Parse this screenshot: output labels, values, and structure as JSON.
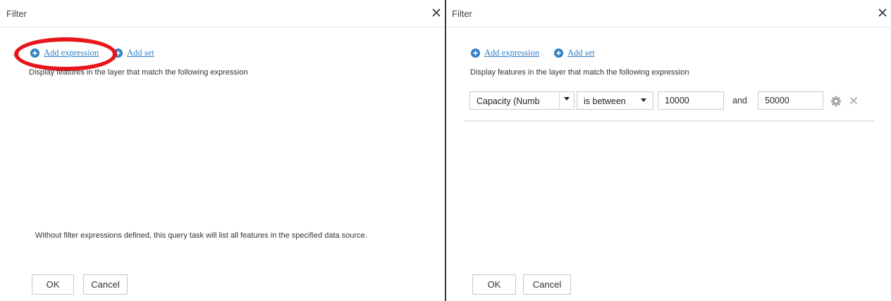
{
  "left_dialog": {
    "title": "Filter",
    "add_expression": "Add expression",
    "add_set": "Add set",
    "description": "Display features in the layer that match the following expression",
    "note": "Without filter expressions defined, this query task will list all features in the specified data source.",
    "ok": "OK",
    "cancel": "Cancel"
  },
  "right_dialog": {
    "title": "Filter",
    "add_expression": "Add expression",
    "add_set": "Add set",
    "description": "Display features in the layer that match the following expression",
    "expression": {
      "field": "Capacity (Numb",
      "operator": "is between",
      "value1": "10000",
      "conjunction": "and",
      "value2": "50000"
    },
    "ok": "OK",
    "cancel": "Cancel"
  },
  "colors": {
    "link": "#2f7fc4",
    "highlight": "#e8151b",
    "icon_gray": "#a6a6a6"
  },
  "icons": {
    "close": "close-icon",
    "add": "plus-circle-icon",
    "dropdown": "caret-down-icon",
    "settings": "gear-icon",
    "remove": "x-icon"
  }
}
